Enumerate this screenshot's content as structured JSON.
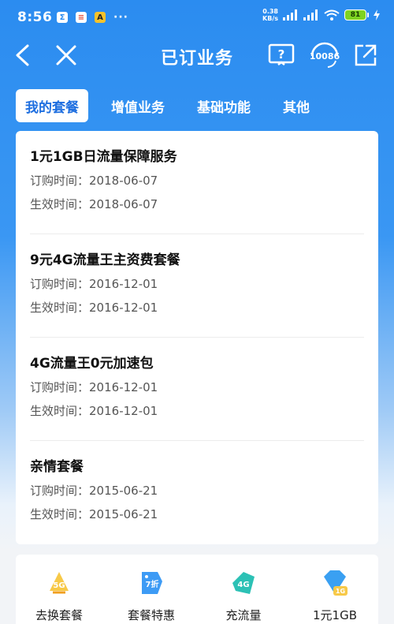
{
  "status": {
    "time": "8:56",
    "app_icons": [
      "Σ",
      "≡",
      "A"
    ],
    "dots": "···",
    "net_speed_top": "0.38",
    "net_speed_bottom": "KB/s",
    "battery": "81"
  },
  "nav": {
    "title": "已订业务",
    "service_number": "10086"
  },
  "tabs": [
    {
      "label": "我的套餐",
      "active": true
    },
    {
      "label": "增值业务",
      "active": false
    },
    {
      "label": "基础功能",
      "active": false
    },
    {
      "label": "其他",
      "active": false
    }
  ],
  "plans": [
    {
      "name": "1元1GB日流量保障服务",
      "order_label": "订购时间：",
      "order_date": "2018-06-07",
      "effective_label": "生效时间：",
      "effective_date": "2018-06-07"
    },
    {
      "name": "9元4G流量王主资费套餐",
      "order_label": "订购时间：",
      "order_date": "2016-12-01",
      "effective_label": "生效时间：",
      "effective_date": "2016-12-01"
    },
    {
      "name": "4G流量王0元加速包",
      "order_label": "订购时间：",
      "order_date": "2016-12-01",
      "effective_label": "生效时间：",
      "effective_date": "2016-12-01"
    },
    {
      "name": "亲情套餐",
      "order_label": "订购时间：",
      "order_date": "2015-06-21",
      "effective_label": "生效时间：",
      "effective_date": "2015-06-21"
    }
  ],
  "quick_actions": [
    {
      "label": "去换套餐",
      "icon": "5g-icon",
      "badge": "5G"
    },
    {
      "label": "套餐特惠",
      "icon": "discount-tag-icon",
      "badge": "7折"
    },
    {
      "label": "充流量",
      "icon": "data-tag-icon",
      "badge": "4G"
    },
    {
      "label": "1元1GB",
      "icon": "diamond-icon",
      "badge": "1G"
    }
  ],
  "colors": {
    "brand_blue": "#2b8cf0",
    "active_tab_text": "#1f6fe0",
    "battery_green": "#7ed321"
  }
}
